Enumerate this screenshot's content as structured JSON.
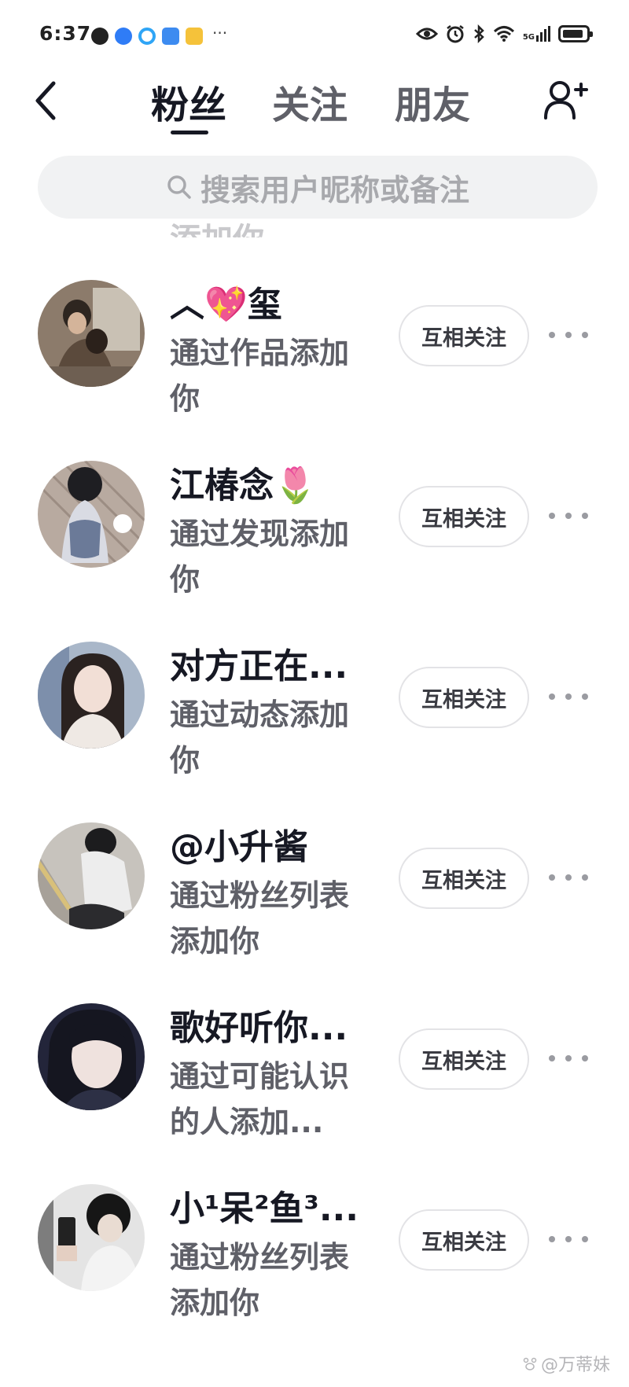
{
  "status_bar": {
    "time": "6:37",
    "more": "···",
    "network": "5G",
    "battery_level": 0.9,
    "app_icons": [
      "message-icon",
      "app-blue-icon",
      "cloud-icon",
      "app-folder-icon",
      "app-notes-icon"
    ]
  },
  "nav": {
    "tabs": [
      {
        "label": "粉丝",
        "active": true
      },
      {
        "label": "关注",
        "active": false
      },
      {
        "label": "朋友",
        "active": false
      }
    ]
  },
  "search": {
    "placeholder": "搜索用户昵称或备注"
  },
  "list": {
    "prev_fragment": "添加你",
    "rows": [
      {
        "name": "︿💖玺",
        "source": "通过作品添加你",
        "button": "互相关注"
      },
      {
        "name": "江椿念🌷",
        "source": "通过发现添加你",
        "button": "互相关注"
      },
      {
        "name": "对方正在...",
        "source": "通过动态添加你",
        "button": "互相关注"
      },
      {
        "name": "@小升酱",
        "source": "通过粉丝列表添加你",
        "button": "互相关注"
      },
      {
        "name": "歌好听你...",
        "source": "通过可能认识的人添加...",
        "button": "互相关注"
      },
      {
        "name": "小¹呆²鱼³...",
        "source": "通过粉丝列表添加你",
        "button": "互相关注"
      }
    ]
  },
  "watermark": "@万蒂妹",
  "colors": {
    "text_primary": "#161823",
    "text_secondary": "#5f6068",
    "search_bg": "#f1f2f3",
    "button_border": "#e3e3e6"
  }
}
